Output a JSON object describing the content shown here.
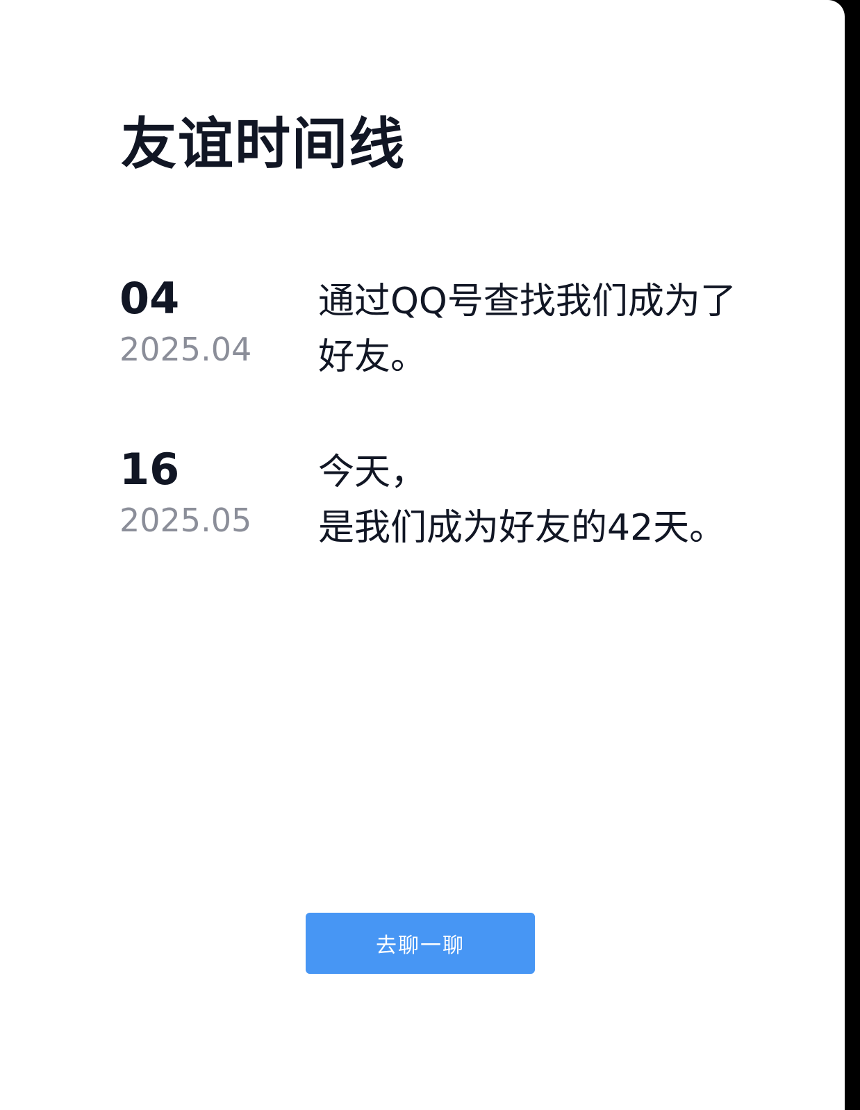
{
  "page": {
    "title": "友谊时间线"
  },
  "timeline": [
    {
      "day": "04",
      "month": "2025.04",
      "lines": [
        "通过QQ号查找我们成为了",
        "好友。"
      ]
    },
    {
      "day": "16",
      "month": "2025.05",
      "lines": [
        "今天，",
        "是我们成为好友的42天。"
      ]
    }
  ],
  "actions": {
    "chat_label": "去聊一聊"
  },
  "colors": {
    "accent": "#4796f4",
    "text_primary": "#111624",
    "text_secondary": "#8b8e99",
    "background": "#ffffff"
  }
}
